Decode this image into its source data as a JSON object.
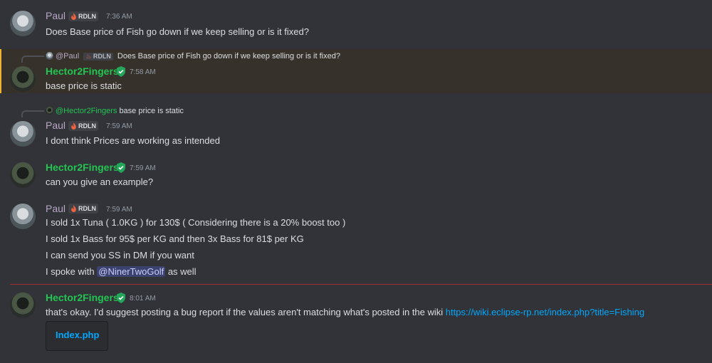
{
  "users": {
    "paul": {
      "name": "Paul",
      "tag": "RDLN",
      "name_color": "#b7a7c4"
    },
    "hector": {
      "name": "Hector2Fingers",
      "name_color": "#23c552"
    }
  },
  "messages": [
    {
      "timestamp": "7:36 AM",
      "lines": [
        "Does Base price of Fish go down if we keep selling or is it fixed?"
      ]
    },
    {
      "reply": {
        "mention": "@Paul",
        "tag": "RDLN",
        "text": "Does Base price of Fish go down if we keep selling or is it fixed?"
      },
      "timestamp": "7:58 AM",
      "lines": [
        "base price is static"
      ]
    },
    {
      "reply": {
        "mention": "@Hector2Fingers",
        "text": "base price is static"
      },
      "timestamp": "7:59 AM",
      "lines": [
        "I dont think Prices are working as intended"
      ]
    },
    {
      "timestamp": "7:59 AM",
      "lines": [
        "can you give an example?"
      ]
    },
    {
      "timestamp": "7:59 AM",
      "lines": [
        "I sold 1x Tuna ( 1.0KG ) for 130$ ( Considering there is a 20% boost too )",
        "I sold 1x Bass for 95$ per KG and then 3x Bass for 81$ per KG",
        "I can send you SS in DM if you want",
        "I spoke with "
      ],
      "mention": "@NinerTwoGolf",
      "line4_suffix": " as well"
    },
    {
      "timestamp": "8:01 AM",
      "lines": [
        "that's okay.  I'd suggest posting a bug report if the values aren't matching what's posted in the wiki "
      ],
      "link": "https://wiki.eclipse-rp.net/index.php?title=Fishing",
      "embed_title": "Index.php"
    }
  ],
  "colors": {
    "background": "#313338",
    "highlight": "#36322b",
    "highlight_border": "#f0b232",
    "new_divider": "#a12d2f",
    "link": "#00a8fc",
    "mention_bg": "#3c4270"
  },
  "icons": {
    "tag_icon": "flame-icon",
    "role_icon": "shield-icon"
  }
}
